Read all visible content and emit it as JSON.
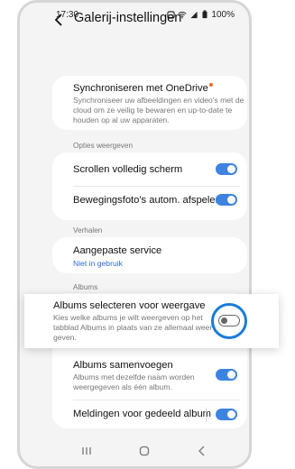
{
  "status_bar": {
    "time": "17:30",
    "battery": "100%"
  },
  "header": {
    "title": "Galerij-instellingen",
    "back_icon": "chevron-left-icon"
  },
  "onedrive": {
    "title": "Synchroniseren met OneDrive",
    "description": "Synchroniseer uw afbeeldingen en video's met de cloud om ze veilig te bewaren en up-to-date te houden op al uw apparaten.",
    "badge_color": "#f06a2b"
  },
  "sections": {
    "display_options": "Opties weergeven",
    "stories": "Verhalen",
    "albums": "Albums"
  },
  "display_options": [
    {
      "label": "Scrollen volledig scherm",
      "enabled": true
    },
    {
      "label": "Bewegingsfoto's autom. afspelen",
      "enabled": true
    }
  ],
  "stories": {
    "title": "Aangepaste service",
    "status": "Niet in gebruik"
  },
  "albums": {
    "select_albums": {
      "title": "Albums selecteren voor weergave",
      "description": "Kies welke albums je wilt weergeven op het tabblad Albums in plaats van ze allemaal weer te geven.",
      "enabled": false
    },
    "merge": {
      "title": "Albums samenvoegen",
      "description": "Albums met dezelfde naam worden weergegeven als één album.",
      "enabled": true
    },
    "shared_notifications": {
      "title": "Meldingen voor gedeeld album",
      "enabled": true
    }
  },
  "accent_color": "#3e83e0",
  "navbar": {
    "icons": [
      "recents-icon",
      "home-icon",
      "back-icon"
    ]
  }
}
